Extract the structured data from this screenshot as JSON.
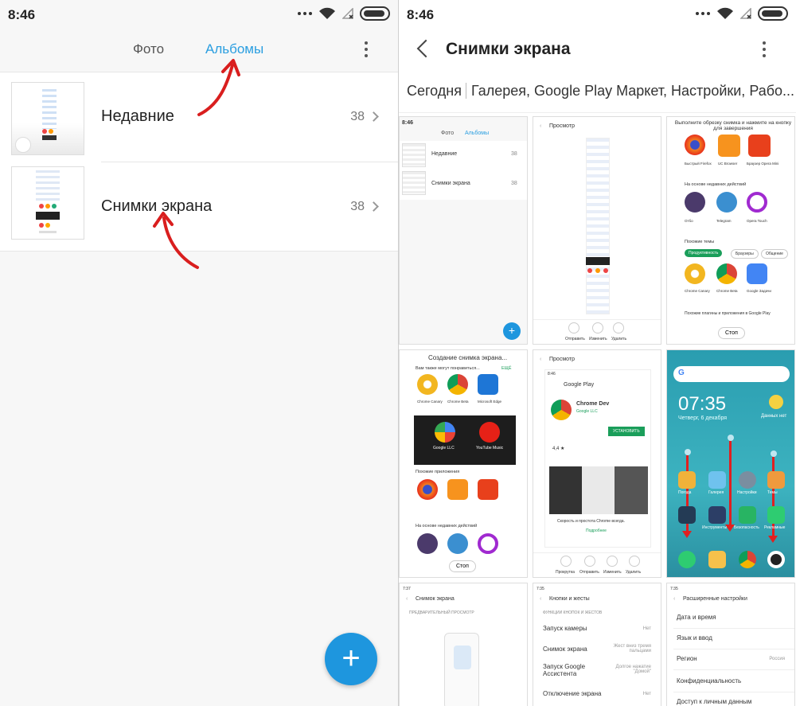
{
  "status_bar": {
    "time_left": "8:46",
    "time_right": "8:46"
  },
  "left_screen": {
    "tabs": {
      "photos": "Фото",
      "albums": "Альбомы"
    },
    "albums": [
      {
        "name": "Недавние",
        "count": "38"
      },
      {
        "name": "Снимки экрана",
        "count": "38"
      }
    ]
  },
  "right_screen": {
    "title": "Снимки экрана",
    "date_header": {
      "date": "Сегодня",
      "apps": "Галерея, Google Play Маркет, Настройки, Рабо..."
    },
    "thumbs": {
      "t1": {
        "time": "8:46",
        "tab_photos": "Фото",
        "tab_albums": "Альбомы",
        "row1": "Недавние",
        "row2": "Снимки экрана",
        "count": "38"
      },
      "t2": {
        "title": "Просмотр",
        "btn1": "Отправить",
        "btn2": "Изменить",
        "btn3": "Удалить"
      },
      "t3": {
        "hint": "Выполните обрезку снимка и нажмите на кнопку для завершения",
        "apps": [
          "Быстрый Firefox",
          "UC Browser",
          "Браузер Opera Mini"
        ],
        "recent_label": "На основе недавних действий",
        "apps2": [
          "Отбо",
          "Telegram",
          "Opera Touch"
        ],
        "similar_label": "Похожие темы",
        "chip1": "Продуктивность",
        "chip2": "Браузеры",
        "chip3": "Общение",
        "apps3": [
          "Chrome Canary",
          "Chrome Beta",
          "Google Задачи"
        ],
        "footer": "Похожие плагины и приложения в Google Play",
        "stop": "Стоп"
      },
      "t4": {
        "title": "Создание снимка экрана...",
        "label1": "Вам также могут понравиться...",
        "more": "ЕЩЁ",
        "apps": [
          "Chrome Canary",
          "Chrome Beta",
          "Microsoft Edge"
        ],
        "banner": "Google LLC",
        "banner2": "YouTube Music",
        "label2": "Похожие приложения",
        "label3": "На основе недавних действий",
        "stop": "Стоп"
      },
      "t5": {
        "title": "Просмотр",
        "time": "8:46",
        "store": "Google Play",
        "app_name": "Chrome Dev",
        "dev": "Google LLC",
        "install": "УСТАНОВИТЬ",
        "rating": "4,4 ★",
        "desc": "Скорость и простота Chrome всегда.",
        "more": "Подробнее",
        "btn1": "Прокрутка",
        "btn2": "Отправить",
        "btn3": "Изменить",
        "btn4": "Удалить"
      },
      "t6": {
        "clock": "07:35",
        "date": "Четверг, 6 декабря",
        "weather": "Данных нет",
        "apps": [
          "Погода",
          "Галерея",
          "Настройки",
          "Темы"
        ],
        "apps2": [
          "",
          "Инструменты",
          "Безопасность",
          "Рекламные"
        ]
      },
      "t7": {
        "time": "7:37",
        "title": "Снимок экрана",
        "section": "ПРЕДВАРИТЕЛЬНЫЙ ПРОСМОТР"
      },
      "t8": {
        "time": "7:35",
        "title": "Кнопки и жесты",
        "section": "ФУНКЦИИ КНОПОК И ЖЕСТОВ",
        "rows": [
          {
            "label": "Запуск камеры",
            "value": "Нет"
          },
          {
            "label": "Снимок экрана",
            "value": "Жест вниз тремя пальцами"
          },
          {
            "label": "Запуск Google Ассистента",
            "value": "Долгое нажатие \"Домой\""
          },
          {
            "label": "Отключение экрана",
            "value": "Нет"
          }
        ]
      },
      "t9": {
        "time": "7:35",
        "title": "Расширенные настройки",
        "rows": [
          {
            "label": "Дата и время",
            "value": ""
          },
          {
            "label": "Язык и ввод",
            "value": ""
          },
          {
            "label": "Регион",
            "value": "Россия"
          },
          {
            "label": "Конфиденциальность",
            "value": ""
          },
          {
            "label": "Доступ к личным данным",
            "value": ""
          }
        ]
      }
    }
  },
  "colors": {
    "accent": "#2a9ee0",
    "fab": "#1e96de",
    "annotation_arrow": "#d91e1e"
  }
}
